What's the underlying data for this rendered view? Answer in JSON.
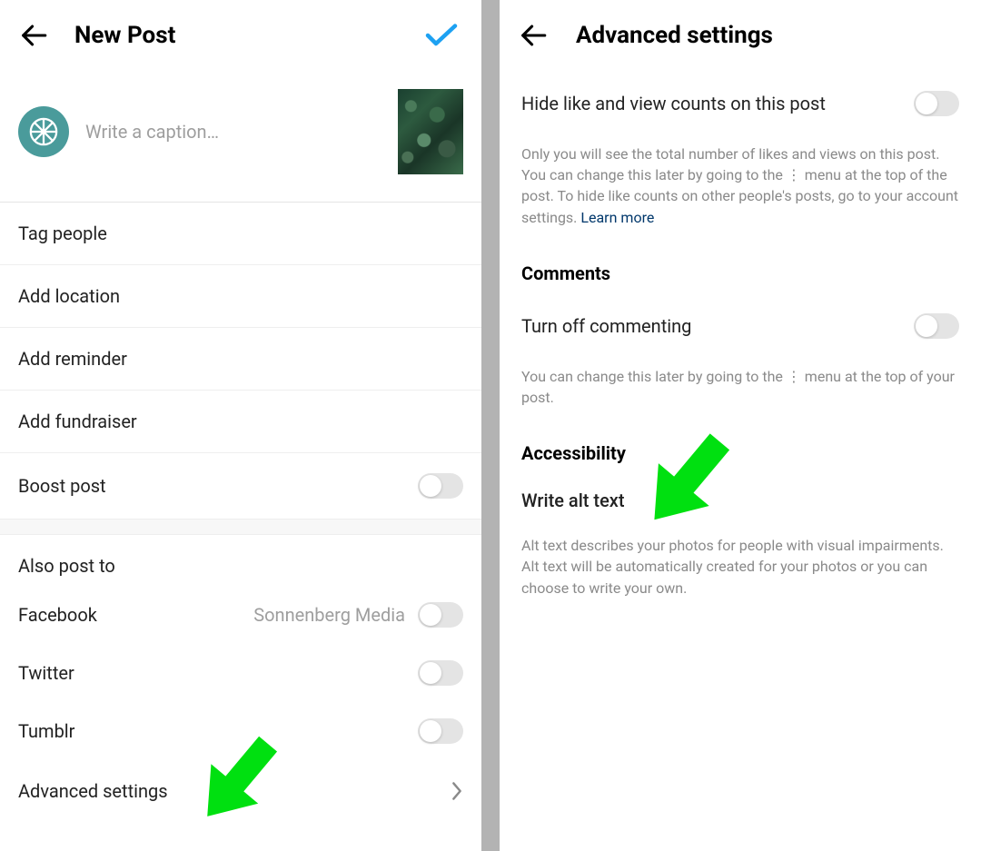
{
  "left": {
    "header_title": "New Post",
    "caption_placeholder": "Write a caption…",
    "rows": {
      "tag_people": "Tag people",
      "add_location": "Add location",
      "add_reminder": "Add reminder",
      "add_fundraiser": "Add fundraiser",
      "boost_post": "Boost post"
    },
    "share_section": "Also post to",
    "share": {
      "facebook_label": "Facebook",
      "facebook_account": "Sonnenberg Media",
      "twitter_label": "Twitter",
      "tumblr_label": "Tumblr"
    },
    "advanced_label": "Advanced settings"
  },
  "right": {
    "header_title": "Advanced settings",
    "hide_counts_label": "Hide like and view counts on this post",
    "hide_counts_desc": "Only you will see the total number of likes and views on this post. You can change this later by going to the ⋮ menu at the top of the post. To hide like counts on other people's posts, go to your account settings. ",
    "learn_more": "Learn more",
    "comments_section": "Comments",
    "turn_off_label": "Turn off commenting",
    "turn_off_desc": "You can change this later by going to the ⋮ menu at the top of your post.",
    "accessibility_section": "Accessibility",
    "alt_text_label": "Write alt text",
    "alt_text_desc": "Alt text describes your photos for people with visual impairments. Alt text will be automatically created for your photos or you can choose to write your own."
  }
}
